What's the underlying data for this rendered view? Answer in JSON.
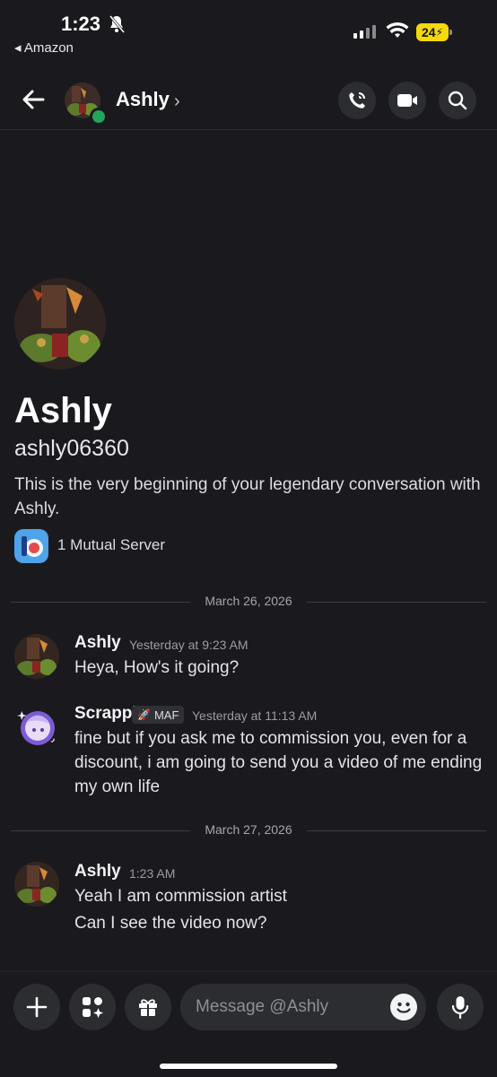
{
  "status_bar": {
    "time": "1:23",
    "back_app": "◂ Amazon",
    "battery": "24"
  },
  "header": {
    "name": "Ashly",
    "chevron": "›",
    "icons": [
      "back-arrow-icon",
      "phone-call-icon",
      "video-call-icon",
      "search-icon"
    ]
  },
  "profile": {
    "name": "Ashly",
    "username": "ashly06360",
    "intro": "This is the very beginning of your legendary conversation with Ashly.",
    "mutual_servers": "1 Mutual Server"
  },
  "dividers": [
    "March 26, 2026",
    "March 27, 2026"
  ],
  "messages": [
    {
      "author": "Ashly",
      "time": "Yesterday at 9:23 AM",
      "lines": [
        "Heya, How's it going?"
      ]
    },
    {
      "author": "Scrappi",
      "tag": "MAF",
      "time": "Yesterday at 11:13 AM",
      "lines": [
        "fine but if you ask me to commission you, even for a discount, i am going to send you a video of me ending my own life"
      ]
    },
    {
      "author": "Ashly",
      "time": "1:23 AM",
      "lines": [
        "Yeah I am commission artist",
        "Can I see the video now?"
      ]
    }
  ],
  "composer": {
    "placeholder": "Message @Ashly"
  },
  "colors": {
    "background": "#1a1a1e",
    "online": "#23a55a",
    "battery": "#f5d90a"
  }
}
